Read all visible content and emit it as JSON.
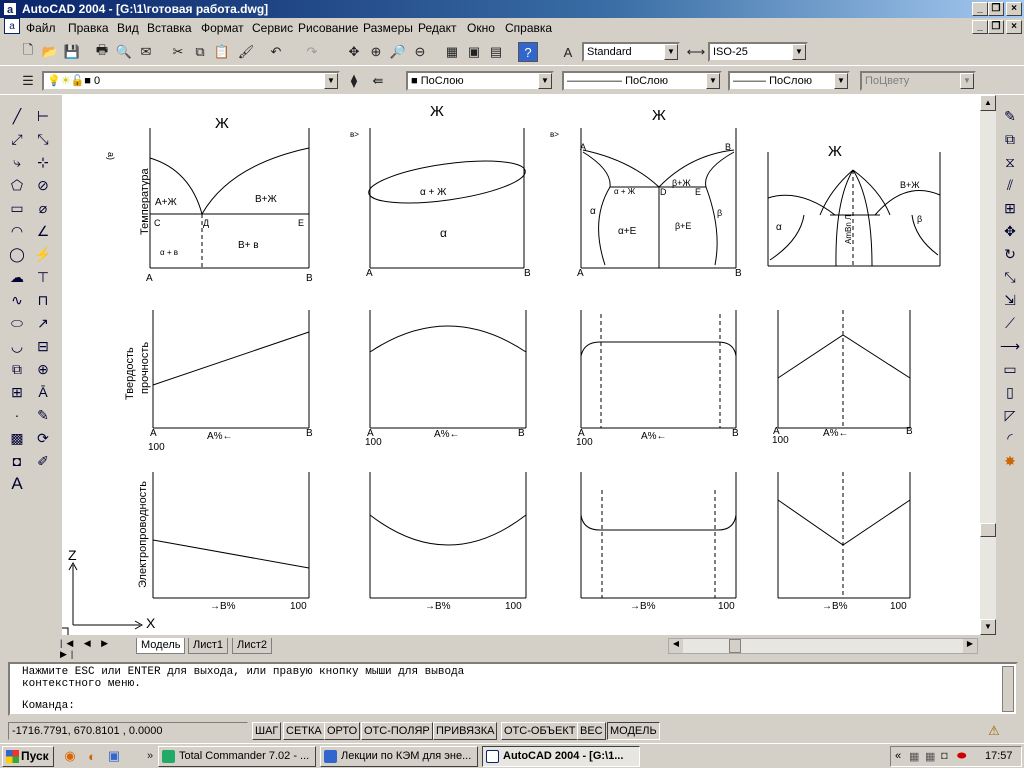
{
  "window": {
    "title": "AutoCAD 2004 - [G:\\1\\готовая работа.dwg]",
    "app_icon": "autocad-icon"
  },
  "menu": [
    "Файл",
    "Правка",
    "Вид",
    "Вставка",
    "Формат",
    "Сервис",
    "Рисование",
    "Размеры",
    "Редакт",
    "Окно",
    "Справка"
  ],
  "toolbar": {
    "text_style": "Standard",
    "dim_style": "ISO-25",
    "layer": "0",
    "color": "ПоСлою",
    "linetype": "ПоСлою",
    "lineweight": "ПоСлою",
    "plotstyle": "ПоЦвету"
  },
  "drawing": {
    "row1": {
      "panel_letter": "а)",
      "ylabel": "Температура",
      "liquid_symbol": "Ж",
      "p1": {
        "A_plus_L": "A+Ж",
        "B_plus_L": "B+Ж",
        "C": "C",
        "D": "Д",
        "E": "E",
        "left_bottom": "α + в",
        "B_plus_B": "B+ в",
        "A": "A",
        "B": "B"
      },
      "p2": {
        "top_mark": "в>",
        "alpha_L": "α + Ж",
        "alpha": "α",
        "A": "A",
        "B": "B"
      },
      "p3": {
        "top_mark": "в>",
        "A": "A",
        "B": "B",
        "C": "C",
        "D": "D",
        "E": "E",
        "alpha_L": "α + Ж",
        "beta_L": "β+Ж",
        "alpha": "α",
        "alpha_E": "α+E",
        "beta_E": "β+E",
        "beta": "β"
      },
      "p4": {
        "alpha": "α",
        "beta": "β",
        "beta_L": "B+Ж",
        "compound": "AmBn Л"
      }
    },
    "row2": {
      "ylabel1": "Твердость",
      "ylabel2": "прочность",
      "A": "A",
      "B": "B",
      "a_percent": "A%←",
      "hundred": "100"
    },
    "row3": {
      "ylabel": "Электропроводность",
      "b_percent": "→B%",
      "hundred": "100"
    },
    "ucs": {
      "z": "Z",
      "x": "X"
    }
  },
  "layout_tabs": [
    "Модель",
    "Лист1",
    "Лист2"
  ],
  "command": {
    "line1": "Нажмите ESC или ENTER для выхода, или правую кнопку мыши для вывода",
    "line2": "контекстного меню.",
    "prompt": "Команда:"
  },
  "status": {
    "coords": "-1716.7791, 670.8101 , 0.0000",
    "buttons": [
      "ШАГ",
      "СЕТКА",
      "ОРТО",
      "ОТС-ПОЛЯР",
      "ПРИВЯЗКА",
      "ОТС-ОБЪЕКТ",
      "ВЕС",
      "МОДЕЛЬ"
    ]
  },
  "taskbar": {
    "start": "Пуск",
    "tasks": [
      "Total Commander 7.02 - ...",
      "Лекции по КЭМ для эне...",
      "AutoCAD 2004 - [G:\\1..."
    ],
    "time": "17:57"
  }
}
